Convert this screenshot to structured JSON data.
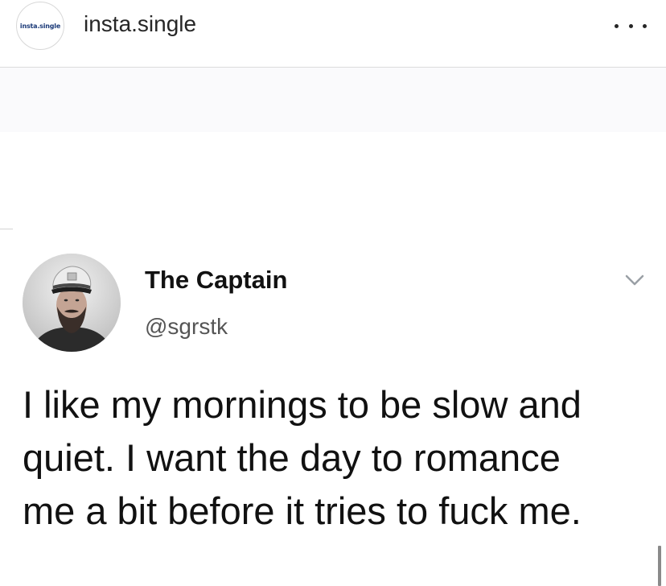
{
  "post_header": {
    "account_avatar_text": "insta.single",
    "account_name": "insta.single",
    "more_icon": "more-horizontal-icon"
  },
  "tweet": {
    "author_name": "The Captain",
    "handle": "@sgrstk",
    "chevron_icon": "chevron-down-icon",
    "text": "I like my mornings to be slow and\nquiet. I want the day to romance\nme a bit before it tries to fuck me."
  },
  "colors": {
    "text_primary": "#111111",
    "text_secondary": "#555555",
    "header_border": "#dcdcdc",
    "avatar_text": "#1b3a78"
  }
}
